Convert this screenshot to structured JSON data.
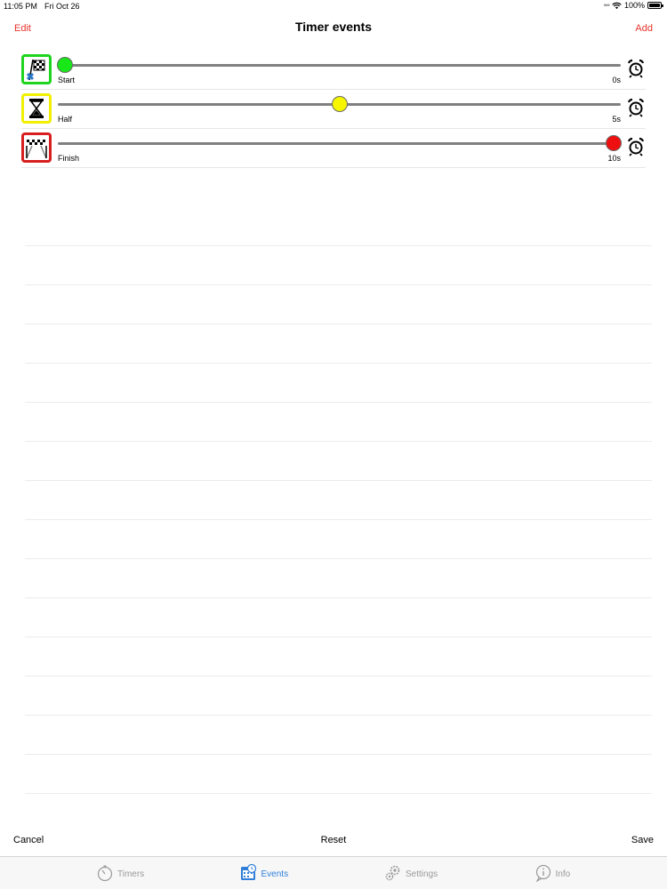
{
  "status_bar": {
    "time": "11:05 PM",
    "date": "Fri Oct 26",
    "battery": "100%"
  },
  "nav": {
    "left_label": "Edit",
    "title": "Timer events",
    "right_label": "Add",
    "accent_color": "#e8322c"
  },
  "events": [
    {
      "label": "Start",
      "time": "0s",
      "position": 0.0,
      "thumb_color": "#18e818",
      "icon": "checkered-flag-icon",
      "icon_border": "#1fd41f"
    },
    {
      "label": "Half",
      "time": "5s",
      "position": 0.5,
      "thumb_color": "#f6f600",
      "icon": "hourglass-icon",
      "icon_border": "#f0f000"
    },
    {
      "label": "Finish",
      "time": "10s",
      "position": 1.0,
      "thumb_color": "#ee1010",
      "icon": "finish-line-icon",
      "icon_border": "#d81e1e"
    }
  ],
  "actions": {
    "cancel": "Cancel",
    "reset": "Reset",
    "save": "Save"
  },
  "tabs": [
    {
      "label": "Timers",
      "icon": "stopwatch-icon",
      "active": false
    },
    {
      "label": "Events",
      "icon": "calendar-clock-icon",
      "active": true
    },
    {
      "label": "Settings",
      "icon": "gears-icon",
      "active": false
    },
    {
      "label": "Info",
      "icon": "info-bubble-icon",
      "active": false
    }
  ],
  "colors": {
    "tab_active": "#2f7ed8",
    "tab_inactive": "#9a9a9a"
  }
}
